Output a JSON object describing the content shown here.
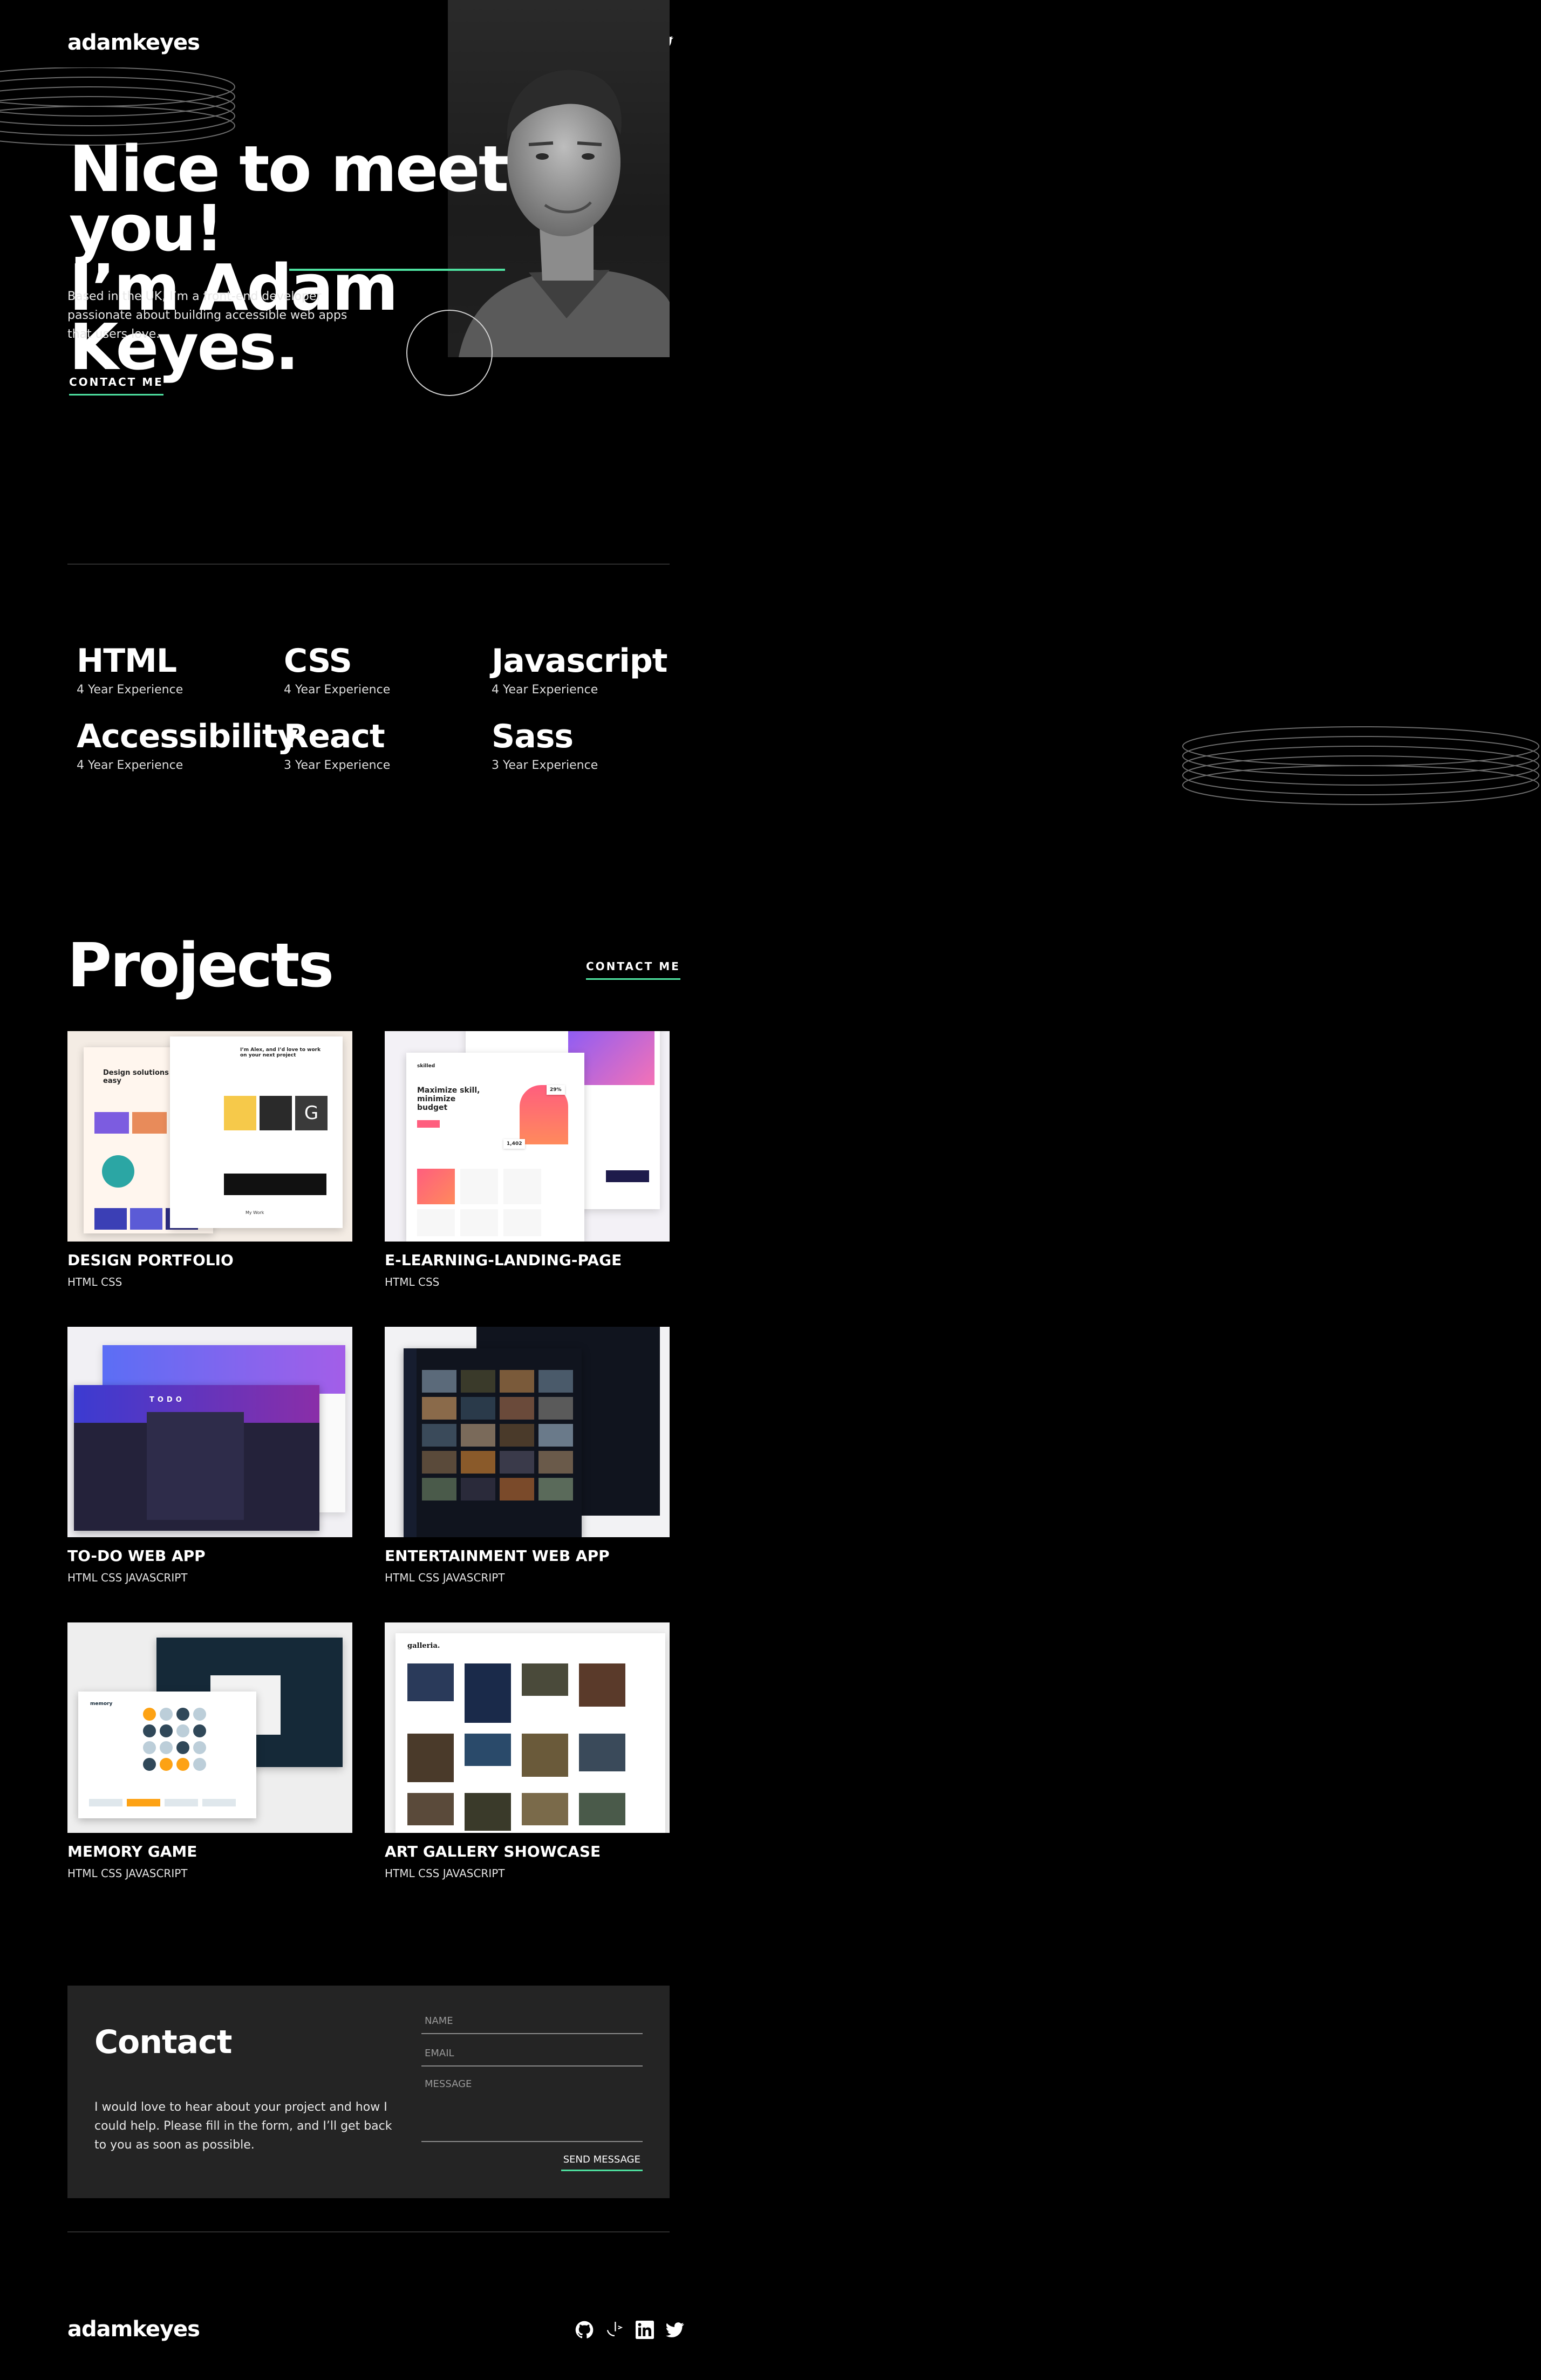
{
  "header": {
    "logo": "adamkeyes",
    "social": [
      {
        "icon": "github-icon"
      },
      {
        "icon": "frontend-mentor-icon"
      },
      {
        "icon": "linkedin-icon"
      },
      {
        "icon": "twitter-icon"
      }
    ]
  },
  "hero": {
    "title_line1": "Nice to meet you!",
    "title_line2_prefix": "I’m ",
    "title_line2_name": "Adam Keyes.",
    "description": "Based in the UK, I’m a front-end developer passionate about building accessible web apps that users love.",
    "cta": "CONTACT ME"
  },
  "skills": [
    {
      "name": "HTML",
      "experience": "4 Year Experience"
    },
    {
      "name": "CSS",
      "experience": "4 Year Experience"
    },
    {
      "name": "Javascript",
      "experience": "4 Year Experience"
    },
    {
      "name": "Accessibility",
      "experience": "4 Year Experience"
    },
    {
      "name": "React",
      "experience": "3 Year Experience"
    },
    {
      "name": "Sass",
      "experience": "3 Year Experience"
    }
  ],
  "projects": {
    "heading": "Projects",
    "cta": "CONTACT ME",
    "items": [
      {
        "title": "DESIGN PORTFOLIO",
        "tags": "HTML CSS"
      },
      {
        "title": "E-LEARNING-LANDING-PAGE",
        "tags": "HTML CSS"
      },
      {
        "title": "TO-DO WEB APP",
        "tags": "HTML CSS JAVASCRIPT"
      },
      {
        "title": "ENTERTAINMENT WEB APP",
        "tags": "HTML CSS JAVASCRIPT"
      },
      {
        "title": "MEMORY GAME",
        "tags": "HTML CSS JAVASCRIPT"
      },
      {
        "title": "ART GALLERY SHOWCASE",
        "tags": "HTML CSS JAVASCRIPT"
      }
    ],
    "thumb_texts": {
      "portfolio_heading": "Design solutions made easy",
      "portfolio_sub": "I’m Alex, and I’d love to work on your next project",
      "portfolio_my_work": "My Work",
      "elearning_heading": "Maximize skill, minimize budget",
      "elearning_logo": "skilled",
      "elearning_stat": "1,402",
      "elearning_pct": "29%",
      "todo_title": "TODO",
      "memory_title": "memory",
      "gallery_logo": "galleria."
    }
  },
  "contact": {
    "heading": "Contact",
    "description": "I would love to hear about your project and how I could help. Please fill in the form, and I’ll get back to you as soon as possible.",
    "name_placeholder": "NAME",
    "email_placeholder": "EMAIL",
    "message_placeholder": "MESSAGE",
    "send": "SEND MESSAGE"
  },
  "footer": {
    "logo": "adamkeyes"
  },
  "colors": {
    "background": "#000000",
    "accent": "#4EE1A0",
    "card": "#242424"
  }
}
